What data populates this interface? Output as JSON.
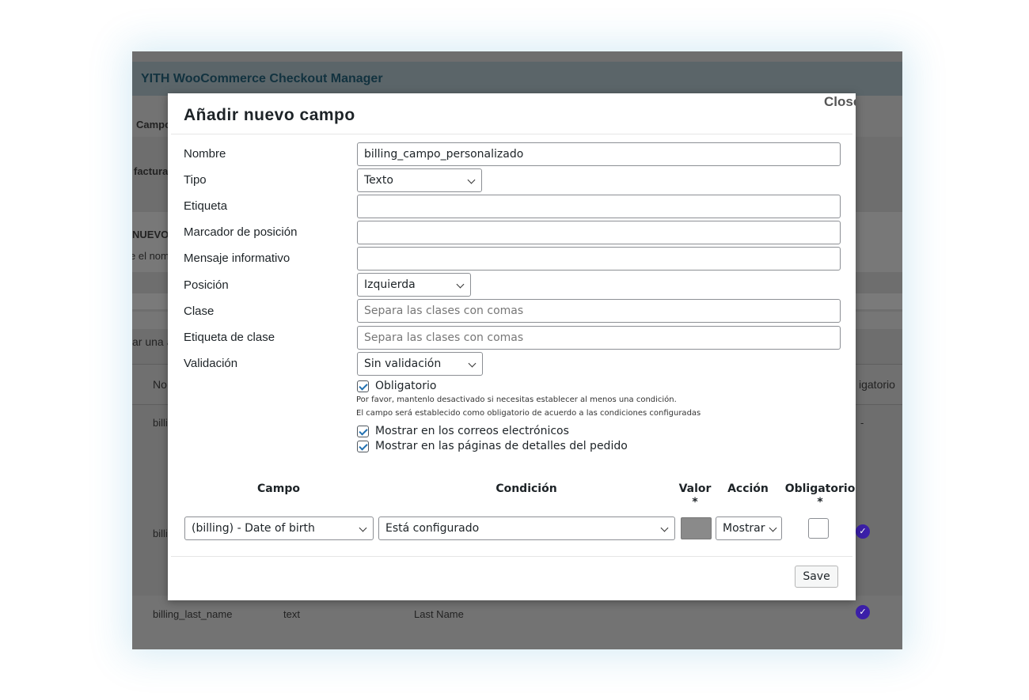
{
  "app": {
    "title": "YITH WooCommerce Checkout Manager",
    "bg_tab_fragment": "Campo",
    "bg_section_fragment": "factura",
    "bg_new_fragment": "NUEVO",
    "bg_desc_fragment": "e el nom",
    "bg_action_fragment": "ar una a",
    "bg_col_name_fragment": "No",
    "bg_col_required_fragment": "igatorio",
    "bg_row1_name_fragment": "billi",
    "bg_row1_dash": "-",
    "bg_row2_name_fragment": "billi",
    "bg_row3": {
      "name": "billing_last_name",
      "type": "text",
      "label": "Last Name"
    }
  },
  "modal": {
    "title": "Añadir nuevo campo",
    "close_label": "Close",
    "fields": {
      "nombre": {
        "label": "Nombre",
        "value": "billing_campo_personalizado"
      },
      "tipo": {
        "label": "Tipo",
        "value": "Texto"
      },
      "etiqueta": {
        "label": "Etiqueta",
        "value": ""
      },
      "marcador": {
        "label": "Marcador de posición",
        "value": ""
      },
      "mensaje": {
        "label": "Mensaje informativo",
        "value": ""
      },
      "posicion": {
        "label": "Posición",
        "value": "Izquierda"
      },
      "clase": {
        "label": "Clase",
        "placeholder": "Separa las clases con comas"
      },
      "etiqueta_clase": {
        "label": "Etiqueta de clase",
        "placeholder": "Separa las clases con comas"
      },
      "validacion": {
        "label": "Validación",
        "value": "Sin validación"
      }
    },
    "obligatorio": {
      "label": "Obligatorio",
      "checked": true,
      "note1": "Por favor, mantenlo desactivado si necesitas establecer al menos una condición.",
      "note2": "El campo será establecido como obligatorio de acuerdo a las condiciones configuradas"
    },
    "mostrar_correos": {
      "label": "Mostrar en los correos electrónicos",
      "checked": true
    },
    "mostrar_pedido": {
      "label": "Mostrar en las páginas de detalles del pedido",
      "checked": true
    },
    "conditions": {
      "headers": {
        "campo": "Campo",
        "condicion": "Condición",
        "valor": "Valor",
        "accion": "Acción",
        "obligatorio": "Obligatorio",
        "required_mark": "*"
      },
      "row": {
        "campo": "(billing) - Date of birth",
        "condicion": "Está configurado",
        "accion": "Mostrar",
        "obligatorio_checked": false
      }
    },
    "save_label": "Save"
  },
  "colors": {
    "overlay_bg": "#6e6e6e",
    "header_bg": "#5b6569",
    "title_color": "#12323f",
    "check_badge": "#3b1fa8",
    "checkbox_tick": "#2271b1"
  }
}
